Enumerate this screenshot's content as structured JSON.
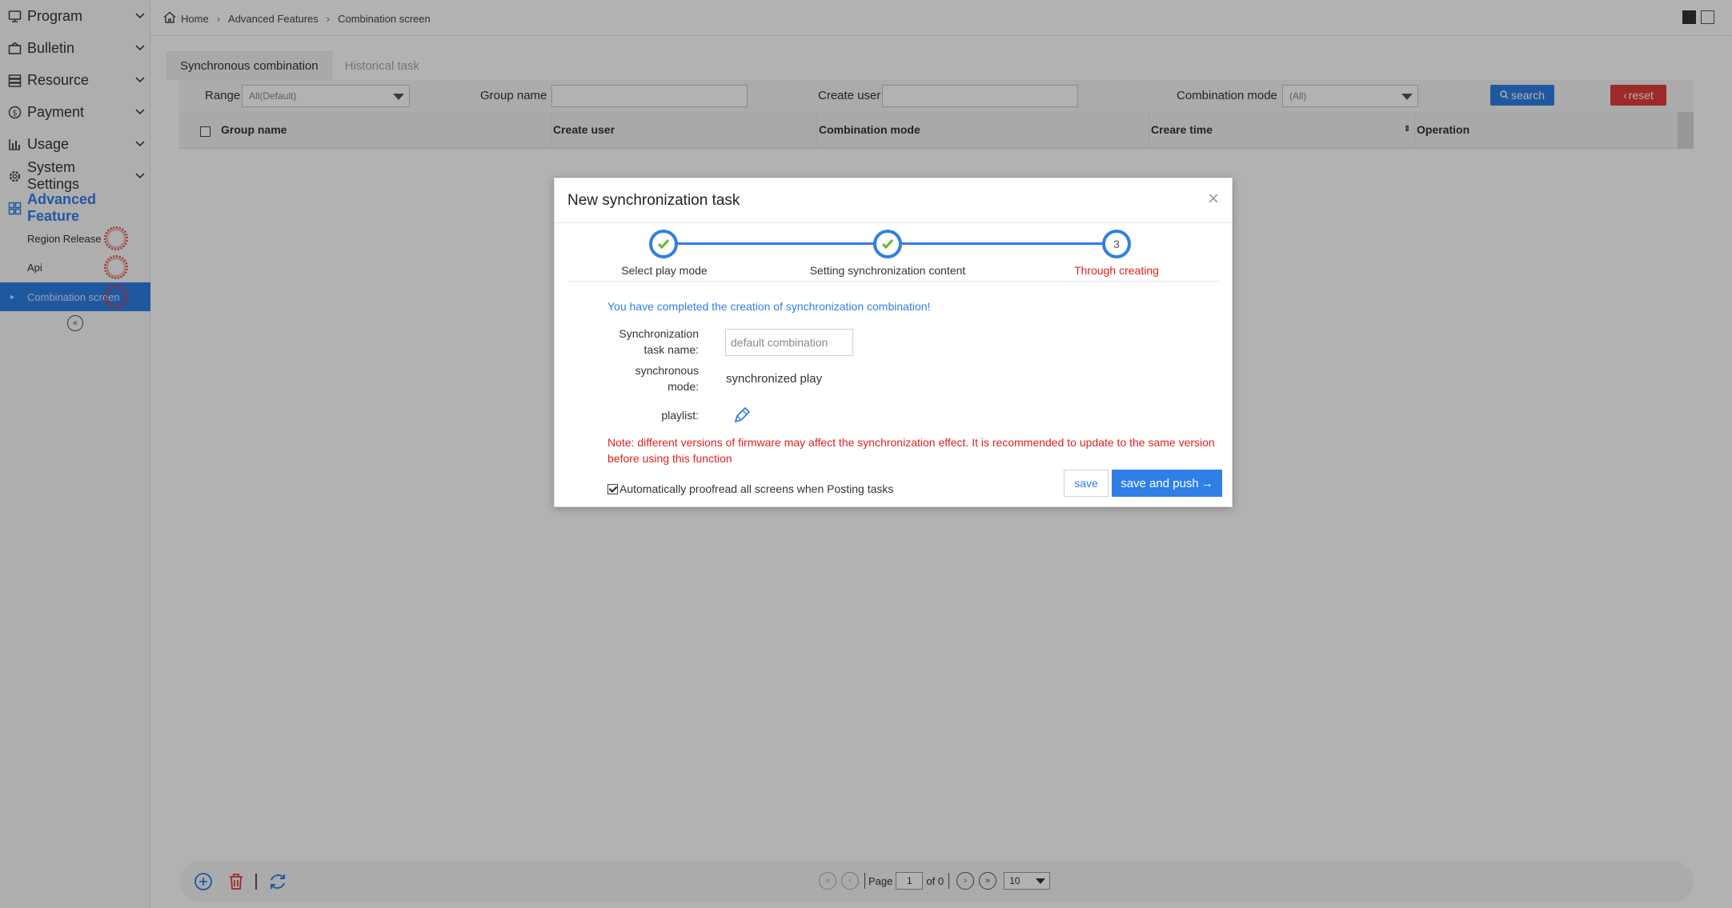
{
  "sidebar": {
    "menu": [
      {
        "label": "Program",
        "icon": "monitor-icon"
      },
      {
        "label": "Bulletin",
        "icon": "bulletin-icon"
      },
      {
        "label": "Resource",
        "icon": "resource-icon"
      },
      {
        "label": "Payment",
        "icon": "payment-icon"
      },
      {
        "label": "Usage",
        "icon": "bar-chart-icon"
      },
      {
        "label": "System Settings",
        "icon": "gear-icon"
      },
      {
        "label": "Advanced Feature",
        "icon": "grid-icon"
      }
    ],
    "sub_items": [
      {
        "label": "Region Release"
      },
      {
        "label": "Api"
      },
      {
        "label": "Combination screen"
      }
    ]
  },
  "breadcrumb": {
    "home": "Home",
    "section": "Advanced Features",
    "page": "Combination screen"
  },
  "tabs": [
    {
      "label": "Synchronous combination"
    },
    {
      "label": "Historical task"
    }
  ],
  "filters": {
    "range_label": "Range",
    "range_value": "All(Default)",
    "group_name_label": "Group name",
    "create_user_label": "Create user",
    "combination_mode_label": "Combination mode",
    "combination_mode_value": "(All)",
    "search_label": "search",
    "reset_label": "reset"
  },
  "table": {
    "columns": [
      "Group name",
      "Create user",
      "Combination mode",
      "Creare time",
      "Operation"
    ]
  },
  "pager": {
    "page_label": "Page",
    "page_value": "1",
    "of_label": "of 0",
    "page_size": "10"
  },
  "modal": {
    "title": "New synchronization task",
    "close": "×",
    "steps": [
      {
        "label": "Select play mode",
        "state": "done"
      },
      {
        "label": "Setting synchronization content",
        "state": "done"
      },
      {
        "label": "Through creating",
        "state": "current",
        "number": "3"
      }
    ],
    "done_message": "You have completed the creation of synchronization combination!",
    "task_name_label_1": "Synchronization",
    "task_name_label_2": "task name:",
    "task_name_placeholder": "default combination",
    "mode_label_1": "synchronous",
    "mode_label_2": "mode:",
    "mode_value": "synchronized play",
    "playlist_label": "playlist:",
    "note": "Note: different versions of firmware may affect the synchronization effect. It is recommended to update to the same version before using this function",
    "auto_proofread_label": "Automatically proofread all screens when Posting tasks",
    "save_label": "save",
    "save_push_label": "save and push"
  },
  "colors": {
    "accent": "#2f7fe6",
    "danger": "#e23b3b",
    "success": "#6cb52d"
  }
}
